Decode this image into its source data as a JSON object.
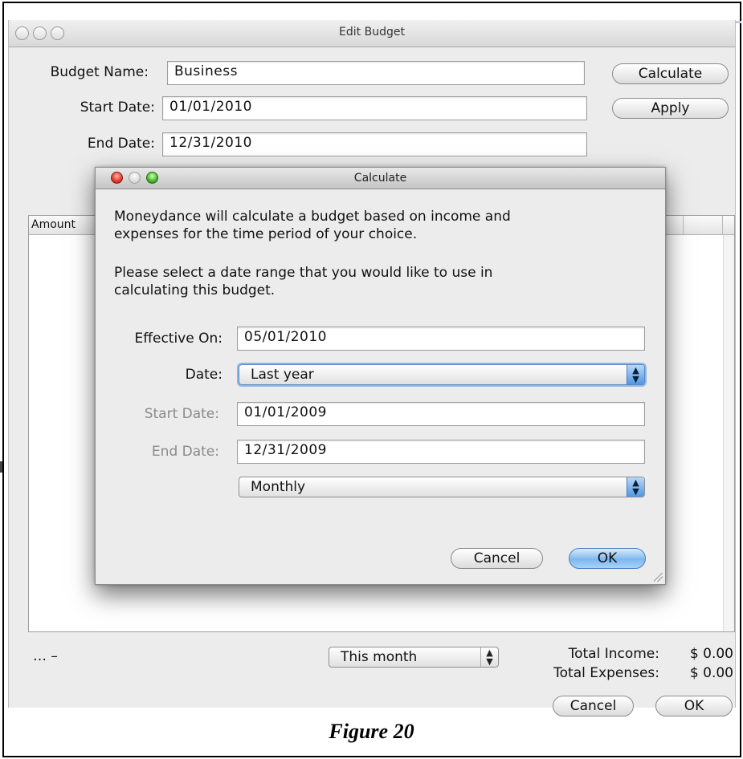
{
  "window": {
    "title": "Edit Budget"
  },
  "form": {
    "budget_name_label": "Budget Name:",
    "budget_name_value": "Business",
    "start_date_label": "Start Date:",
    "start_date_value": "01/01/2010",
    "end_date_label": "End Date:",
    "end_date_value": "12/31/2010",
    "calculate_button": "Calculate",
    "apply_button": "Apply"
  },
  "table": {
    "column_amount": "Amount"
  },
  "footer": {
    "ellipsis": "… –",
    "period_select": "This month",
    "total_income_label": "Total Income:",
    "total_income_value": "$ 0.00",
    "total_expenses_label": "Total Expenses:",
    "total_expenses_value": "$ 0.00",
    "cancel_button": "Cancel",
    "ok_button": "OK"
  },
  "dialog": {
    "title": "Calculate",
    "intro_line1": "Moneydance will calculate a budget based on income and",
    "intro_line2": "expenses for the time period of your choice.",
    "instruction_line1": "Please select a date range that you would like to use in",
    "instruction_line2": "calculating this budget.",
    "effective_on_label": "Effective On:",
    "effective_on_value": "05/01/2010",
    "date_label": "Date:",
    "date_select": "Last year",
    "start_date_label": "Start Date:",
    "start_date_value": "01/01/2009",
    "end_date_label": "End Date:",
    "end_date_value": "12/31/2009",
    "interval_select": "Monthly",
    "cancel_button": "Cancel",
    "ok_button": "OK"
  },
  "caption": "Figure 20",
  "colors": {
    "primary_button": "#7eb7ee",
    "close_button": "#e0352a",
    "zoom_button": "#3fb724"
  }
}
